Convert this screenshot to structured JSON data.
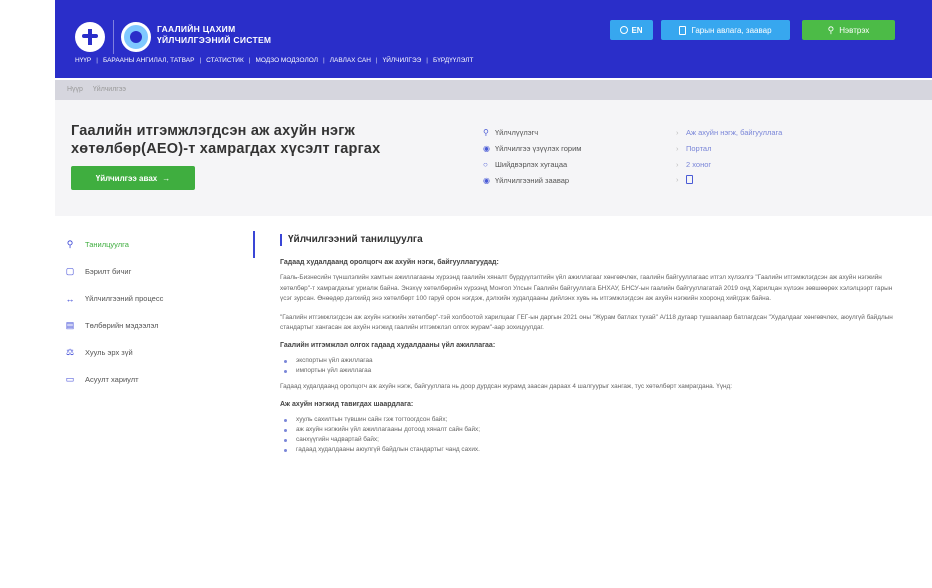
{
  "header": {
    "org_name_line1": "ГААЛИЙН ЦАХИМ",
    "org_name_line2": "ҮЙЛЧИЛГЭЭНИЙ СИСТЕМ",
    "lang_label": "EN",
    "guide_label": "Гарын авлага, заавар",
    "login_label": "Нэвтрэх",
    "nav": [
      "НҮҮР",
      "БАРААНЫ АНГИЛАЛ, ТАТВАР",
      "СТАТИСТИК",
      "МОДЗО МОДЗОЛОЛ",
      "ЛАВЛАХ САН",
      "ҮЙЛЧИЛГЭЭ",
      "БҮРДҮҮЛЭЛТ"
    ],
    "colors": {
      "primary": "#2a2ec9",
      "accent_blue": "#37a7ef",
      "accent_green": "#4cbb47"
    }
  },
  "breadcrumb": [
    "Нүүр",
    "Үйлчилгээ"
  ],
  "hero": {
    "title": "Гаалийн итгэмжлэгдсэн аж ахуйн нэгж хөтөлбөр(AEO)-т хамрагдах хүсэлт гаргах",
    "start_label": "Үйлчилгээ авах",
    "info": [
      {
        "label": "Үйлчлүүлэгч",
        "value": "Аж ахуйн нэгж, байгууллага"
      },
      {
        "label": "Үйлчилгээ үзүүлэх горим",
        "value": "Портал"
      },
      {
        "label": "Шийдвэрлэх хугацаа",
        "value": "2 хоног"
      },
      {
        "label": "Үйлчилгээний заавар",
        "value": ""
      }
    ]
  },
  "sidebar": {
    "items": [
      {
        "label": "Танилцуулга",
        "icon": "user-icon"
      },
      {
        "label": "Бэрилт бичиг",
        "icon": "document-icon"
      },
      {
        "label": "Үйлчилгээний процесс",
        "icon": "process-icon"
      },
      {
        "label": "Төлбөрийн мэдээлэл",
        "icon": "payment-icon"
      },
      {
        "label": "Хууль эрх зүй",
        "icon": "law-icon"
      },
      {
        "label": "Асуулт хариулт",
        "icon": "chat-icon"
      }
    ]
  },
  "content": {
    "title": "Үйлчилгээний танилцуулга",
    "sub1": "Гадаад худалдаанд оролцогч аж ахуйн нэгж, байгууллагуудад:",
    "p1": "Гааль-Бизнесийн түншлэлийн хамтын ажиллагааны хүрээнд гаалийн хяналт бүрдүүлэлтийн үйл ажиллагааг хөнгөвчлөх, гаалийн байгууллагаас итгэл хүлээлгэ \"Гаалийн итгэмжлэгдсэн аж ахуйн нэгжийн хөтөлбөр\"-т хамрагдахыг уриалж байна. Энэхүү хөтөлбөрийн хүрээнд Монгол Улсын Гаалийн байгууллага БНХАУ, БНСУ-ын гаалийн байгууллагатай 2019 онд Харилцан хүлээн зөвшөөрөх хэлэлцээрт гарын үсэг зурсан. Өнөөдөр дэлхийд энэ хөтөлбөрт 100 гаруй орон нэгдэж, дэлхийн худалдааны дийлэнх хувь нь итгэмжлэгдсэн аж ахуйн нэгжийн хооронд хийгдэж байна.",
    "p2": "\"Гаалийн итгэмжлэгдсэн аж ахуйн нэгжийн хөтөлбөр\"-тэй холбоотой харилцааг ГЕГ-ын даргын 2021 оны \"Журам батлах тухай\" А/118 дугаар тушаалаар батлагдсан \"Худалдааг хөнгөвчлөх, аюулгүй байдлын стандартыг хангасан аж ахуйн нэгжид гаалийн итгэмжлэл олгох журам\"-аар зохицуулдаг.",
    "sub2": "Гаалийн итгэмжлэл олгох гадаад худалдааны үйл ажиллагаа:",
    "list1": [
      "экспортын үйл ажиллагаа",
      "импортын үйл ажиллагаа"
    ],
    "p3": "Гадаад худалдаанд оролцогч аж ахуйн нэгж, байгууллага нь доор дурдсан журамд заасан дараах 4 шалгуурыг хангаж, тус хөтөлбөрт хамрагдана. Үүнд:",
    "sub3": "Аж ахуйн нэгжид тавигдах шаардлага:",
    "list2": [
      "хууль сахилтын түвшин сайн гэж тогтоогдсон байх;",
      "аж ахуйн нэгжийн үйл ажиллагааны дотоод хяналт сайн байх;",
      "санхүүгийн чадвартай байх;",
      "гадаад худалдааны аюулгүй байдлын стандартыг чанд сахих."
    ]
  }
}
